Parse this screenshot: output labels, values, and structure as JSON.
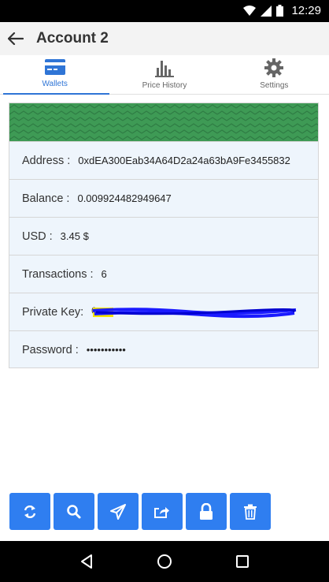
{
  "status_bar": {
    "time": "12:29"
  },
  "header": {
    "title": "Account 2"
  },
  "tabs": [
    {
      "label": "Wallets",
      "icon": "credit-card-icon",
      "active": true
    },
    {
      "label": "Price History",
      "icon": "bar-chart-icon",
      "active": false
    },
    {
      "label": "Settings",
      "icon": "gear-icon",
      "active": false
    }
  ],
  "wallet": {
    "address_label": "Address :",
    "address_value": "0xdEA300Eab34A64D2a24a63bA9Fe3455832",
    "balance_label": "Balance :",
    "balance_value": "0.009924482949647",
    "usd_label": "USD :",
    "usd_value": "3.45 $",
    "transactions_label": "Transactions :",
    "transactions_value": "6",
    "private_key_label": "Private Key:",
    "private_key_value": "0x...",
    "password_label": "Password :",
    "password_value": "•••••••••••"
  },
  "actions": [
    {
      "icon": "refresh-icon"
    },
    {
      "icon": "search-icon"
    },
    {
      "icon": "send-icon"
    },
    {
      "icon": "share-icon"
    },
    {
      "icon": "lock-icon"
    },
    {
      "icon": "trash-icon"
    }
  ],
  "colors": {
    "accent": "#2f75d6",
    "button": "#2f7ef0",
    "banner": "#3e9a55",
    "card_bg": "#eef5fc"
  }
}
